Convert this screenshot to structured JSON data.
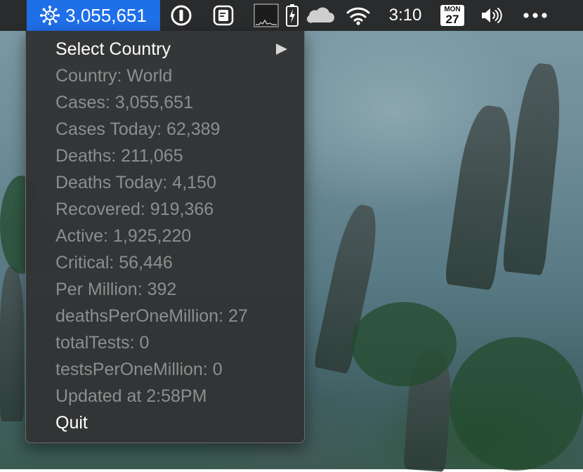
{
  "menubar": {
    "covid_count": "3,055,651",
    "clock": "3:10",
    "calendar_day_of_week": "MON",
    "calendar_day": "27",
    "icons": {
      "covid": "virus-icon",
      "onepassword": "onepassword-icon",
      "notes": "note-icon",
      "activity_monitor": "activity-graph-icon",
      "battery": "battery-charging-icon",
      "onedrive": "cloud-icon",
      "wifi": "wifi-icon",
      "volume": "speaker-volume-icon",
      "more": "ellipsis-icon"
    },
    "accent_color": "#1f6fe8"
  },
  "menu": {
    "select_country": "Select Country",
    "info_items": [
      "Country: World",
      "Cases: 3,055,651",
      "Cases Today: 62,389",
      "Deaths: 211,065",
      "Deaths Today: 4,150",
      "Recovered: 919,366",
      "Active: 1,925,220",
      "Critical: 56,446",
      "Per Million: 392",
      "deathsPerOneMillion: 27",
      "totalTests: 0",
      "testsPerOneMillion: 0",
      "Updated at 2:58PM"
    ],
    "quit": "Quit"
  }
}
